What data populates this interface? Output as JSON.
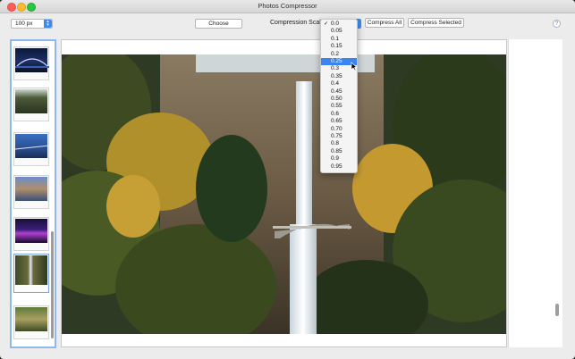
{
  "window": {
    "title": "Photos Compressor"
  },
  "toolbar": {
    "size_value": "100 px",
    "choose_label": "Choose",
    "scale_label": "Compression Scale",
    "compress_all_label": "Compress All",
    "compress_selected_label": "Compress Selected",
    "help_label": "?"
  },
  "scale_menu": {
    "selected": "0.0",
    "highlighted": "0.25",
    "options": [
      "0.0",
      "0.05",
      "0.1",
      "0.15",
      "0.2",
      "0.25",
      "0.3",
      "0.35",
      "0.4",
      "0.45",
      "0.50",
      "0.55",
      "0.6",
      "0.65",
      "0.70",
      "0.75",
      "0.8",
      "0.85",
      "0.9",
      "0.95"
    ]
  },
  "colors": {
    "accent": "#3a84f0",
    "selection_border": "#8fb8f0"
  }
}
